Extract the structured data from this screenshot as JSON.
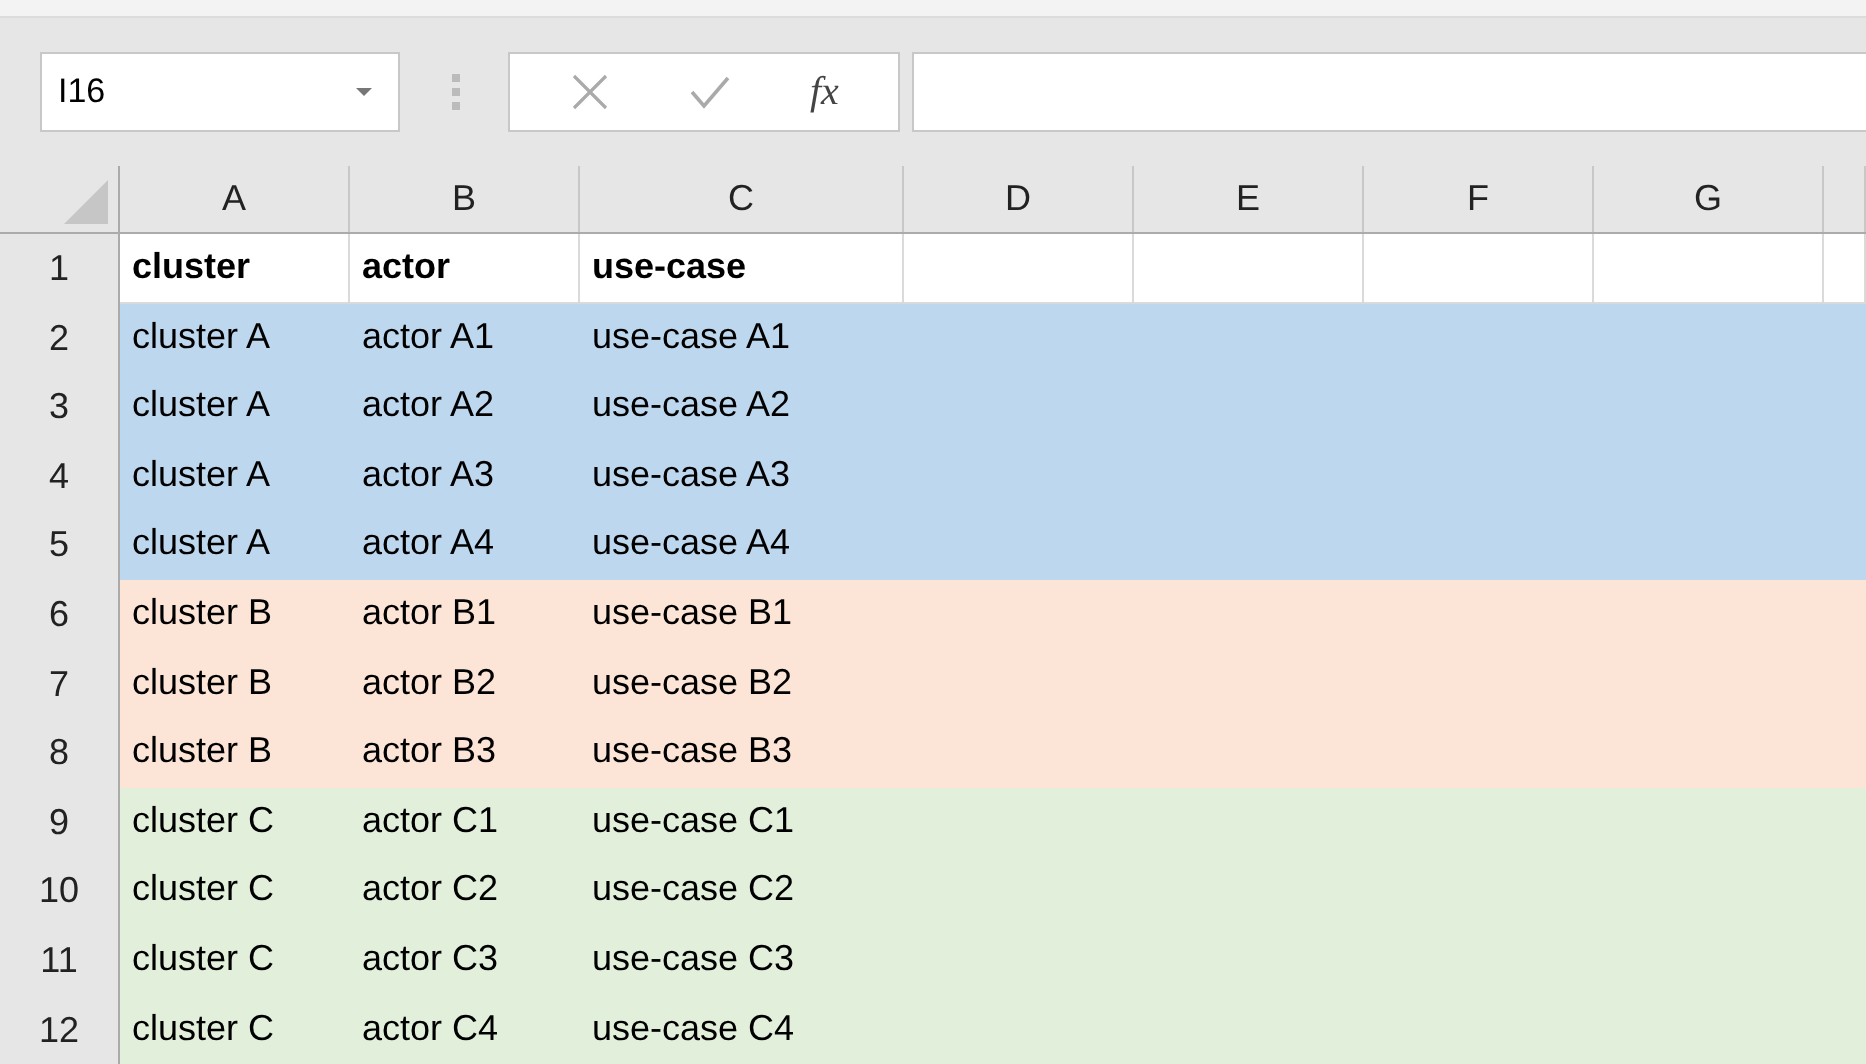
{
  "name_box": {
    "value": "I16"
  },
  "formula_bar": {
    "fx_label": "fx"
  },
  "columns": [
    "A",
    "B",
    "C",
    "D",
    "E",
    "F",
    "G"
  ],
  "rows": [
    {
      "number": "1",
      "kind": "header",
      "cells": [
        "cluster",
        "actor",
        "use-case"
      ]
    },
    {
      "number": "2",
      "kind": "data",
      "color": "#bdd7ee",
      "cells": [
        "cluster A",
        "actor A1",
        "use-case A1"
      ]
    },
    {
      "number": "3",
      "kind": "data",
      "color": "#bdd7ee",
      "cells": [
        "cluster A",
        "actor A2",
        "use-case A2"
      ]
    },
    {
      "number": "4",
      "kind": "data",
      "color": "#bdd7ee",
      "cells": [
        "cluster A",
        "actor A3",
        "use-case A3"
      ]
    },
    {
      "number": "5",
      "kind": "data",
      "color": "#bdd7ee",
      "cells": [
        "cluster A",
        "actor A4",
        "use-case A4"
      ]
    },
    {
      "number": "6",
      "kind": "data",
      "color": "#fce4d6",
      "cells": [
        "cluster B",
        "actor B1",
        "use-case B1"
      ]
    },
    {
      "number": "7",
      "kind": "data",
      "color": "#fce4d6",
      "cells": [
        "cluster B",
        "actor B2",
        "use-case B2"
      ]
    },
    {
      "number": "8",
      "kind": "data",
      "color": "#fce4d6",
      "cells": [
        "cluster B",
        "actor B3",
        "use-case B3"
      ]
    },
    {
      "number": "9",
      "kind": "data",
      "color": "#e2efda",
      "cells": [
        "cluster C",
        "actor C1",
        "use-case C1"
      ]
    },
    {
      "number": "10",
      "kind": "data",
      "color": "#e2efda",
      "cells": [
        "cluster C",
        "actor C2",
        "use-case C2"
      ]
    },
    {
      "number": "11",
      "kind": "data",
      "color": "#e2efda",
      "cells": [
        "cluster C",
        "actor C3",
        "use-case C3"
      ]
    },
    {
      "number": "12",
      "kind": "data",
      "color": "#e2efda",
      "cells": [
        "cluster C",
        "actor C4",
        "use-case C4"
      ]
    }
  ]
}
